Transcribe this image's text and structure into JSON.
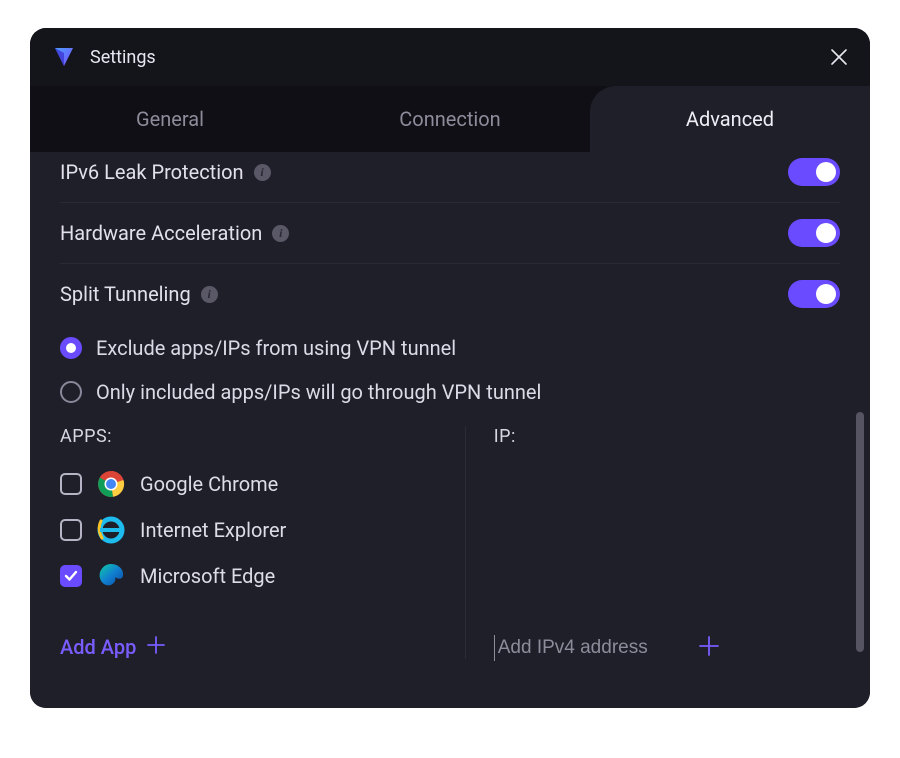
{
  "window": {
    "title": "Settings"
  },
  "tabs": {
    "general": "General",
    "connection": "Connection",
    "advanced": "Advanced"
  },
  "rows": {
    "ipv6": "IPv6 Leak Protection",
    "hardware": "Hardware Acceleration",
    "split": "Split Tunneling"
  },
  "split_options": {
    "exclude": "Exclude apps/IPs from using VPN tunnel",
    "include": "Only included apps/IPs will go through VPN tunnel"
  },
  "columns": {
    "apps_heading": "APPS:",
    "ip_heading": "IP:"
  },
  "apps": [
    {
      "name": "Google Chrome",
      "checked": false,
      "icon": "chrome"
    },
    {
      "name": "Internet Explorer",
      "checked": false,
      "icon": "ie"
    },
    {
      "name": "Microsoft Edge",
      "checked": true,
      "icon": "edge"
    }
  ],
  "actions": {
    "add_app": "Add App",
    "add_ip_placeholder": "Add IPv4 address"
  },
  "colors": {
    "accent": "#6b4bff"
  }
}
